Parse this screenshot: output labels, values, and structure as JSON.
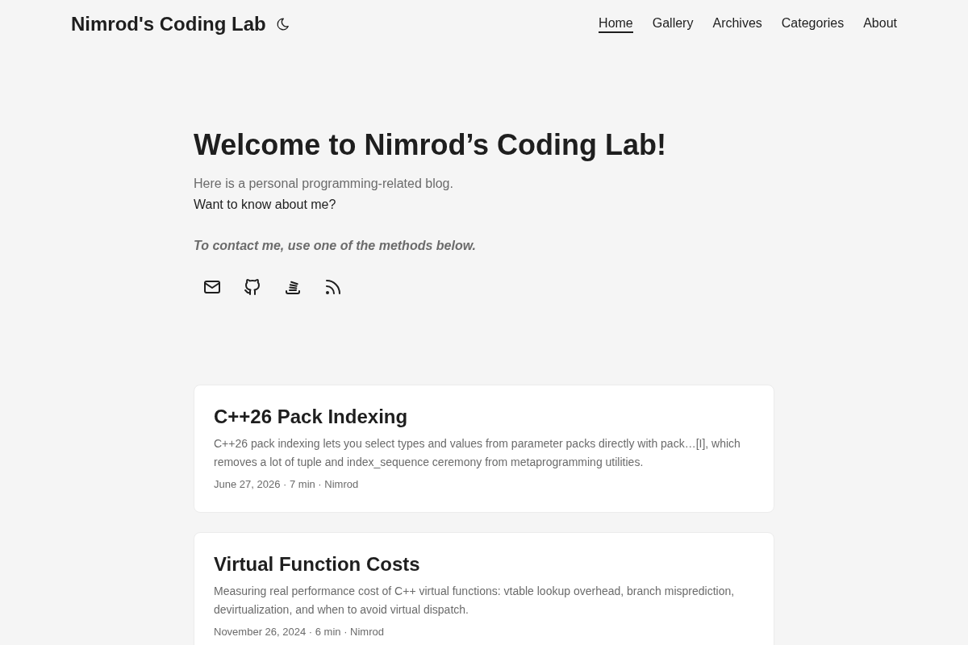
{
  "header": {
    "site_title": "Nimrod's Coding Lab",
    "nav": [
      {
        "label": "Home",
        "selected": true
      },
      {
        "label": "Gallery",
        "selected": false
      },
      {
        "label": "Archives",
        "selected": false
      },
      {
        "label": "Categories",
        "selected": false
      },
      {
        "label": "About",
        "selected": false
      }
    ]
  },
  "hero": {
    "title": "Welcome to Nimrod’s Coding Lab!",
    "intro": "Here is a personal programming-related blog.",
    "about_link": "Want to know about me?",
    "contact_note": "To contact me, use one of the methods below."
  },
  "posts": [
    {
      "title": "C++26 Pack Indexing",
      "summary": "C++26 pack indexing lets you select types and values from parameter packs directly with pack…[I], which removes a lot of tuple and index_sequence ceremony from metaprogramming utilities.",
      "meta": "June 27, 2026 · 7 min · Nimrod"
    },
    {
      "title": "Virtual Function Costs",
      "summary": "Measuring real performance cost of C++ virtual functions: vtable lookup overhead, branch misprediction, devirtualization, and when to avoid virtual dispatch.",
      "meta": "November 26, 2024 · 6 min · Nimrod"
    }
  ]
}
